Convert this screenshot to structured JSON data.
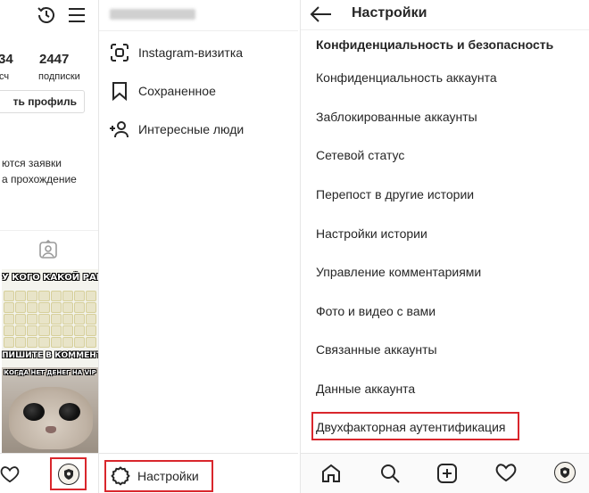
{
  "profile": {
    "stats": [
      {
        "number": "34",
        "label": "сч"
      },
      {
        "number": "2447",
        "label": "подписки"
      }
    ],
    "edit_button": "ть профиль",
    "notice_lines": [
      "ются заявки",
      "а прохождение"
    ],
    "memes": {
      "top_caption": "У КОГО КАКОЙ РАНГ?",
      "bottom_caption": "ПИШИТЕ В КОММЕНТАХ!",
      "cat_caption": "КОГДА НЕТ ДЕНЕГ НА VIP"
    }
  },
  "menu": {
    "items": [
      {
        "icon": "qr-scan-icon",
        "label": "Instagram-визитка"
      },
      {
        "icon": "bookmark-icon",
        "label": "Сохраненное"
      },
      {
        "icon": "add-person-icon",
        "label": "Интересные люди"
      }
    ],
    "settings_label": "Настройки"
  },
  "settings": {
    "title": "Настройки",
    "section_title": "Конфиденциальность и безопасность",
    "items": [
      "Конфиденциальность аккаунта",
      "Заблокированные аккаунты",
      "Сетевой статус",
      "Перепост в другие истории",
      "Настройки истории",
      "Управление комментариями",
      "Фото и видео с вами",
      "Связанные аккаунты",
      "Данные аккаунта",
      "Двухфакторная аутентификация"
    ],
    "bottom_nav": [
      "home-icon",
      "search-icon",
      "new-post-icon",
      "heart-icon",
      "profile-avatar-icon"
    ]
  },
  "colors": {
    "highlight": "#d9262c",
    "text": "#262626",
    "divider": "#e6e6e6"
  }
}
